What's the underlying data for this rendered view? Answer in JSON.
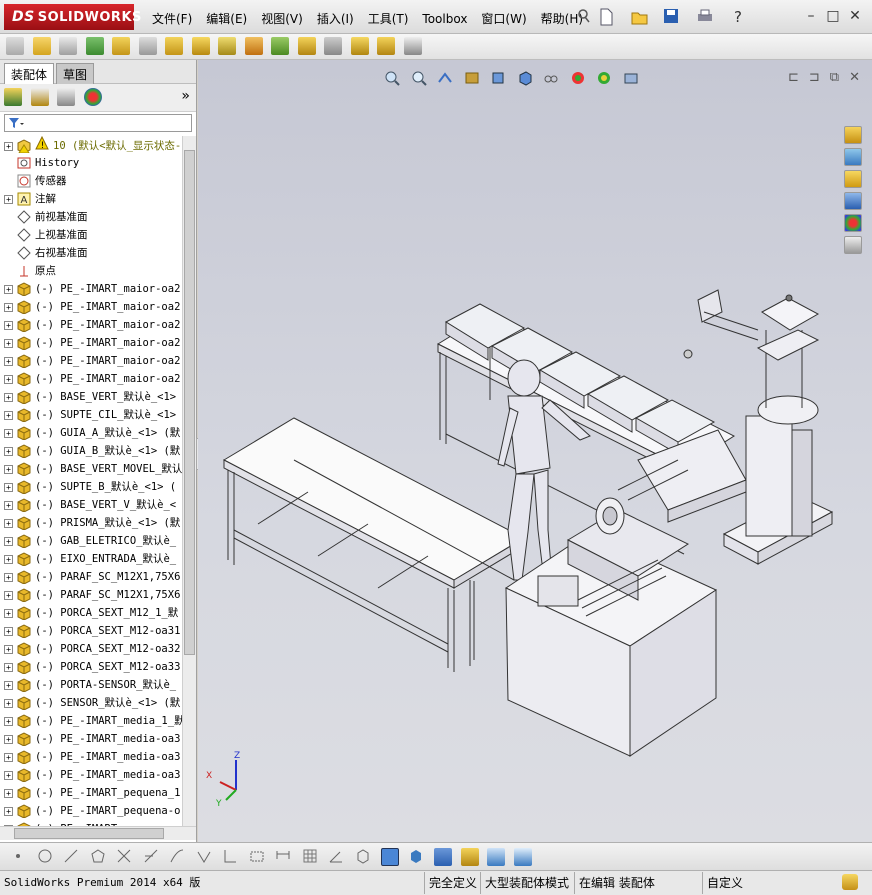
{
  "app": {
    "brand": "SOLIDWORKS"
  },
  "menu": [
    "文件(F)",
    "编辑(E)",
    "视图(V)",
    "插入(I)",
    "工具(T)",
    "Toolbox",
    "窗口(W)",
    "帮助(H)"
  ],
  "panel_tabs": [
    "装配体",
    "草图"
  ],
  "tree": {
    "top_item": "10   (默认<默认_显示状态-",
    "items": [
      {
        "label": "History",
        "type": "history"
      },
      {
        "label": "传感器",
        "type": "sensor"
      },
      {
        "label": "注解",
        "type": "annotation",
        "expand": true
      },
      {
        "label": "前视基准面",
        "type": "plane"
      },
      {
        "label": "上视基准面",
        "type": "plane"
      },
      {
        "label": "右视基准面",
        "type": "plane"
      },
      {
        "label": "原点",
        "type": "origin"
      },
      {
        "label": "(-) PE_-IMART_maior-oa2",
        "type": "part",
        "expand": true
      },
      {
        "label": "(-) PE_-IMART_maior-oa2",
        "type": "part",
        "expand": true
      },
      {
        "label": "(-) PE_-IMART_maior-oa2",
        "type": "part",
        "expand": true
      },
      {
        "label": "(-) PE_-IMART_maior-oa2",
        "type": "part",
        "expand": true
      },
      {
        "label": "(-) PE_-IMART_maior-oa2",
        "type": "part",
        "expand": true
      },
      {
        "label": "(-) PE_-IMART_maior-oa2",
        "type": "part",
        "expand": true
      },
      {
        "label": "(-) BASE_VERT_默认è_<1>",
        "type": "part",
        "expand": true
      },
      {
        "label": "(-) SUPTE_CIL_默认è_<1>",
        "type": "part",
        "expand": true
      },
      {
        "label": "(-) GUIA_A_默认è_<1> (默",
        "type": "part",
        "expand": true
      },
      {
        "label": "(-) GUIA_B_默认è_<1> (默",
        "type": "part",
        "expand": true
      },
      {
        "label": "(-) BASE_VERT_MOVEL_默认",
        "type": "part",
        "expand": true
      },
      {
        "label": "(-) SUPTE_B_默认è_<1> (",
        "type": "part",
        "expand": true
      },
      {
        "label": "(-) BASE_VERT_V_默认è_<",
        "type": "part",
        "expand": true
      },
      {
        "label": "(-) PRISMA_默认è_<1> (默",
        "type": "part",
        "expand": true
      },
      {
        "label": "(-) GAB_ELETRICO_默认è_",
        "type": "part",
        "expand": true
      },
      {
        "label": "(-) EIXO_ENTRADA_默认è_",
        "type": "part",
        "expand": true
      },
      {
        "label": "(-) PARAF_SC_M12X1,75X6",
        "type": "part",
        "expand": true
      },
      {
        "label": "(-) PARAF_SC_M12X1,75X6",
        "type": "part",
        "expand": true
      },
      {
        "label": "(-) PORCA_SEXT_M12_1_默",
        "type": "part",
        "expand": true
      },
      {
        "label": "(-) PORCA_SEXT_M12-oa31",
        "type": "part",
        "expand": true
      },
      {
        "label": "(-) PORCA_SEXT_M12-oa32",
        "type": "part",
        "expand": true
      },
      {
        "label": "(-) PORCA_SEXT_M12-oa33",
        "type": "part",
        "expand": true
      },
      {
        "label": "(-) PORTA-SENSOR_默认è_",
        "type": "part",
        "expand": true
      },
      {
        "label": "(-) SENSOR_默认è_<1> (默",
        "type": "part",
        "expand": true
      },
      {
        "label": "(-) PE_-IMART_media_1_默",
        "type": "part",
        "expand": true
      },
      {
        "label": "(-) PE_-IMART_media-oa3",
        "type": "part",
        "expand": true
      },
      {
        "label": "(-) PE_-IMART_media-oa3",
        "type": "part",
        "expand": true
      },
      {
        "label": "(-) PE_-IMART_media-oa3",
        "type": "part",
        "expand": true
      },
      {
        "label": "(-) PE_-IMART_pequena_1",
        "type": "part",
        "expand": true
      },
      {
        "label": "(-) PE_-IMART_pequena-o",
        "type": "part",
        "expand": true
      },
      {
        "label": "(-) PE_-IMART_pequena-o",
        "type": "part",
        "expand": true
      }
    ]
  },
  "status": {
    "app_version": "SolidWorks Premium 2014 x64 版",
    "definition": "完全定义",
    "mode": "大型装配体模式",
    "editing": "在编辑 装配体",
    "custom": "自定义"
  },
  "colors": {
    "accent_red": "#c8161d",
    "viewport_bg": "#d0d2da",
    "part_icon": "#e0b020"
  }
}
